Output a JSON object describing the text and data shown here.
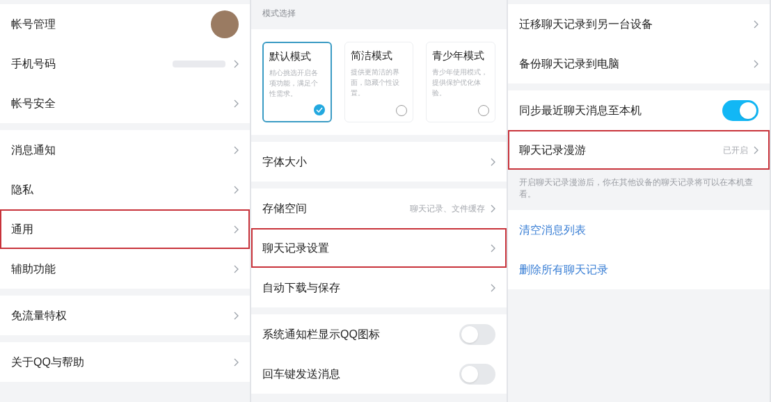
{
  "columns": [
    {
      "groups": [
        {
          "items": [
            {
              "kind": "avatar",
              "label": "帐号管理"
            },
            {
              "kind": "redacted",
              "label": "手机号码"
            },
            {
              "kind": "link",
              "label": "帐号安全"
            }
          ]
        },
        {
          "items": [
            {
              "kind": "link",
              "label": "消息通知"
            },
            {
              "kind": "link",
              "label": "隐私"
            },
            {
              "kind": "link",
              "label": "通用",
              "highlighted": true
            },
            {
              "kind": "link",
              "label": "辅助功能"
            }
          ]
        },
        {
          "items": [
            {
              "kind": "link",
              "label": "免流量特权"
            }
          ]
        },
        {
          "items": [
            {
              "kind": "link",
              "label": "关于QQ与帮助"
            }
          ]
        }
      ]
    },
    {
      "groups": [
        {
          "heading": "模式选择",
          "modes": [
            {
              "title": "默认模式",
              "description": "精心挑选开启各项功能，满足个性需求。",
              "selected": true
            },
            {
              "title": "简洁模式",
              "description": "提供更简洁的界面，隐藏个性设置。",
              "selected": false
            },
            {
              "title": "青少年模式",
              "description": "青少年使用模式，提供保护优化体验。",
              "selected": false
            }
          ]
        },
        {
          "items": [
            {
              "kind": "link",
              "label": "字体大小"
            }
          ]
        },
        {
          "items": [
            {
              "kind": "link",
              "label": "存储空间",
              "value": "聊天记录、文件缓存"
            },
            {
              "kind": "link",
              "label": "聊天记录设置",
              "highlighted": true
            },
            {
              "kind": "link",
              "label": "自动下载与保存"
            }
          ]
        },
        {
          "items": [
            {
              "kind": "toggle",
              "label": "系统通知栏显示QQ图标",
              "on": false
            },
            {
              "kind": "toggle",
              "label": "回车键发送消息",
              "on": false
            }
          ]
        }
      ]
    },
    {
      "groups": [
        {
          "items": [
            {
              "kind": "link",
              "label": "迁移聊天记录到另一台设备"
            },
            {
              "kind": "link",
              "label": "备份聊天记录到电脑"
            }
          ]
        },
        {
          "items": [
            {
              "kind": "toggle",
              "label": "同步最近聊天消息至本机",
              "on": true
            },
            {
              "kind": "link",
              "label": "聊天记录漫游",
              "value": "已开启",
              "highlighted": true
            }
          ],
          "note": "开启聊天记录漫游后，你在其他设备的聊天记录将可以在本机查看。"
        },
        {
          "items": [
            {
              "kind": "action",
              "label": "清空消息列表"
            },
            {
              "kind": "action",
              "label": "删除所有聊天记录"
            }
          ]
        }
      ]
    }
  ]
}
